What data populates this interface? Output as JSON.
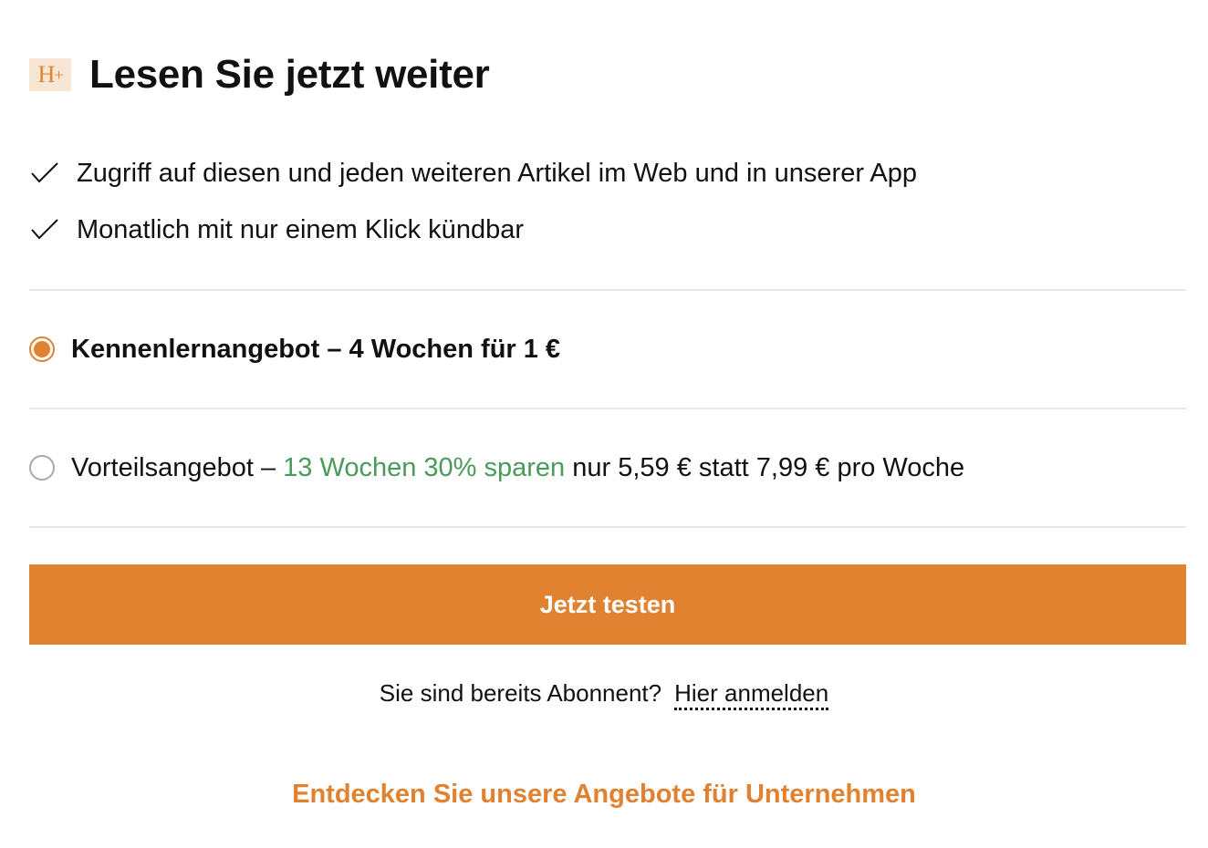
{
  "header": {
    "logo_text": "H",
    "logo_plus": "+",
    "title": "Lesen Sie jetzt weiter"
  },
  "benefits": [
    {
      "icon": "check-icon",
      "text": "Zugriff auf diesen und jeden weiteren Artikel im Web und in unserer App"
    },
    {
      "icon": "check-icon",
      "text": "Monatlich mit nur einem Klick kündbar"
    }
  ],
  "offers": [
    {
      "selected": true,
      "label": "Kennenlernangebot – 4 Wochen für 1 €"
    },
    {
      "selected": false,
      "label_prefix": "Vorteilsangebot – ",
      "label_highlight": "13 Wochen 30% sparen",
      "label_suffix": " nur 5,59 € statt 7,99 € pro Woche"
    }
  ],
  "cta": {
    "label": "Jetzt testen"
  },
  "login": {
    "question": "Sie sind bereits Abonnent?",
    "link_label": "Hier anmelden"
  },
  "business_link": "Entdecken Sie unsere Angebote für Unternehmen",
  "colors": {
    "accent": "#e0822f",
    "logo_bg": "#f7e6d3",
    "highlight_green": "#4a9a5a",
    "divider": "#e6e6e6"
  }
}
